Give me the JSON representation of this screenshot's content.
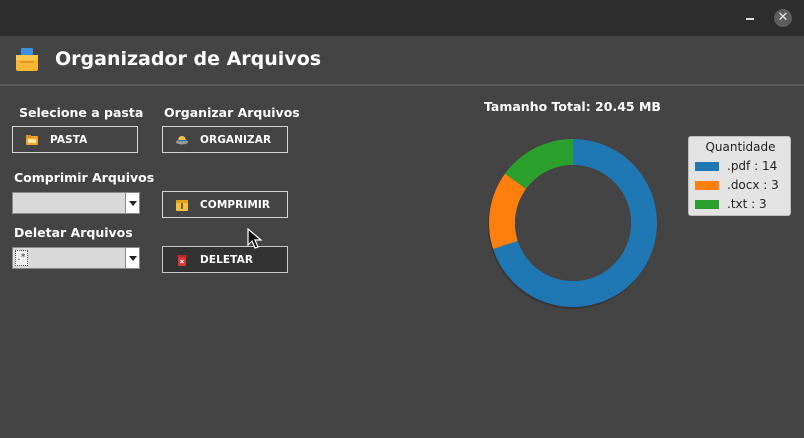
{
  "window": {
    "close_glyph": "✕"
  },
  "app": {
    "title": "Organizador de Arquivos",
    "logo_icon": "folder-stack-icon"
  },
  "sections": {
    "pasta": {
      "label": "Selecione a pasta",
      "button": "PASTA",
      "icon": "folder-icon"
    },
    "organizar": {
      "label": "Organizar Arquivos",
      "button": "ORGANIZAR",
      "icon": "hat-icon"
    },
    "comprimir": {
      "label": "Comprimir Arquivos",
      "button": "COMPRIMIR",
      "icon": "archive-icon",
      "combo_value": ""
    },
    "deletar": {
      "label": "Deletar Arquivos",
      "button": "DELETAR",
      "icon": "trash-icon",
      "combo_value": ".*"
    }
  },
  "summary": {
    "total_label": "Tamanho Total: 20.45 MB"
  },
  "chart_data": {
    "type": "pie",
    "variant": "donut",
    "categories": [
      ".pdf",
      ".docx",
      ".txt"
    ],
    "values": [
      14,
      3,
      3
    ],
    "colors": [
      "#1f77b4",
      "#ff7f0e",
      "#2ca02c"
    ],
    "legend_title": "Quantidade",
    "legend_labels": [
      ".pdf : 14",
      ".docx : 3",
      ".txt : 3"
    ],
    "legend_position": "right"
  }
}
